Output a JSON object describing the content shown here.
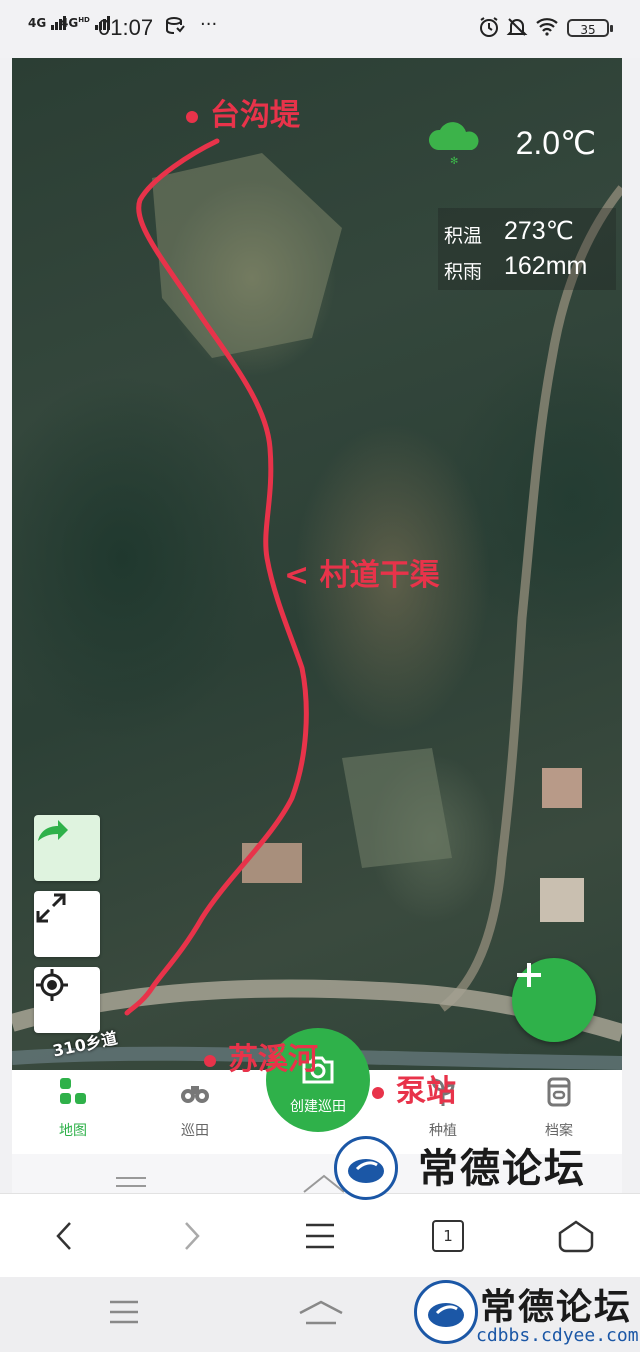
{
  "status_bar": {
    "signal_1": "4G",
    "signal_2": "4G",
    "signal_2_sup": "HD",
    "time": "01:07",
    "more": "···",
    "battery": "35"
  },
  "map": {
    "weather": {
      "temperature": "2.0℃",
      "icon": "cloud-icon"
    },
    "stats": [
      {
        "label": "积温",
        "value": "273℃"
      },
      {
        "label": "积雨",
        "value": "162mm"
      }
    ],
    "annotations": {
      "top_point": "台沟堤",
      "middle_arrow": "< 村道干渠",
      "river": "苏溪河",
      "pump": "泵站"
    },
    "road_label": "310乡道",
    "controls": [
      "navigate-arrow-icon",
      "expand-icon",
      "locate-icon"
    ],
    "accent_color": "#2fb14a",
    "route_color": "#e8334a"
  },
  "tabbar": {
    "tabs": [
      {
        "label": "地图",
        "icon": "map-grid-icon",
        "active": true
      },
      {
        "label": "巡田",
        "icon": "binoculars-icon",
        "active": false
      },
      {
        "label": "种植",
        "icon": "plant-icon",
        "active": false
      },
      {
        "label": "档案",
        "icon": "archive-icon",
        "active": false
      }
    ],
    "create": {
      "label": "创建巡田",
      "icon": "camera-icon"
    }
  },
  "browser_bar": {
    "tab_count": "1"
  },
  "watermark": {
    "title": "常德论坛",
    "url": "cdbbs.cdyee.com"
  }
}
